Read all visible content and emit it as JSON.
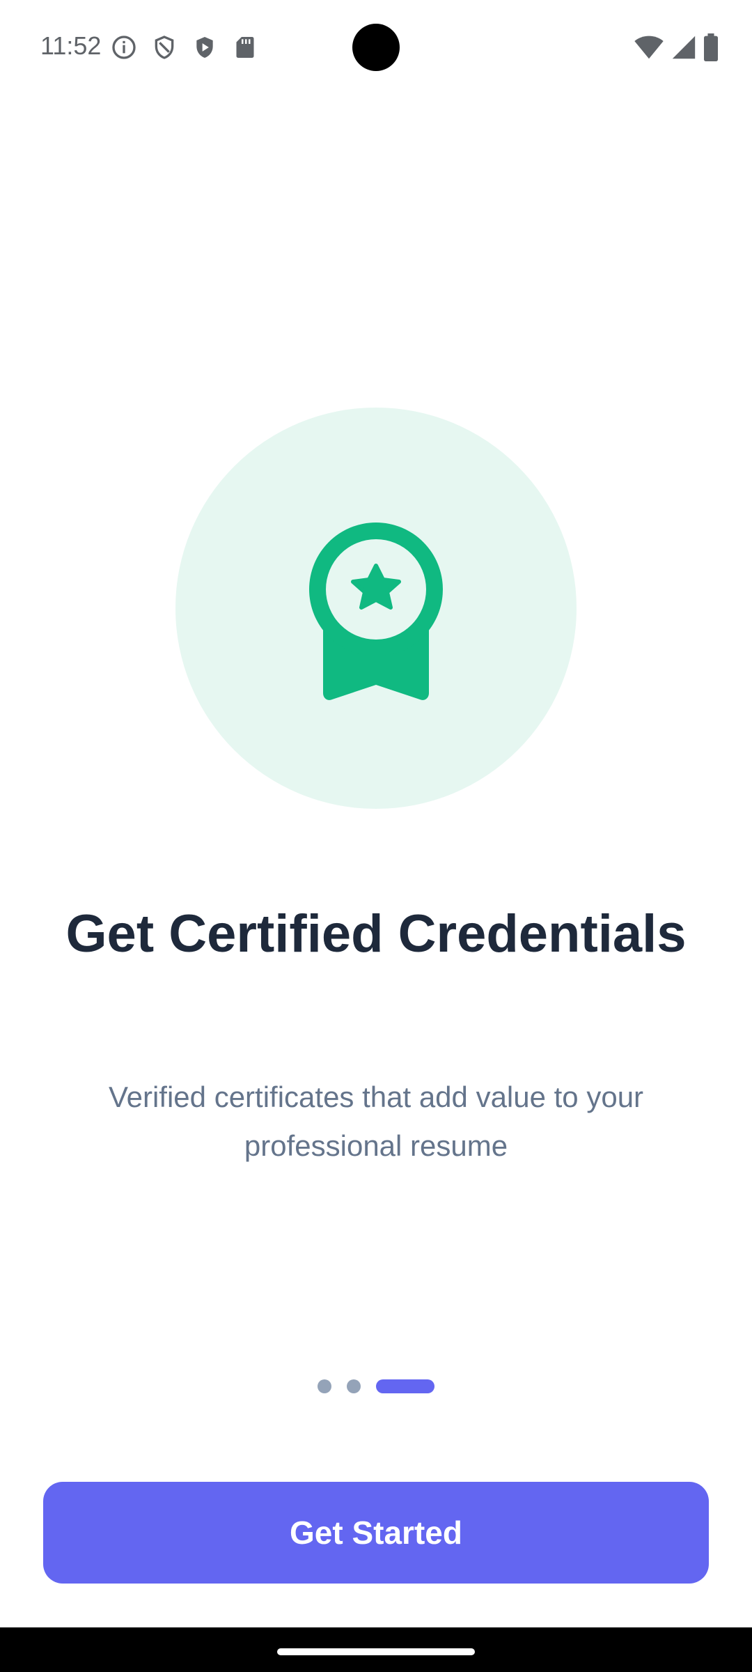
{
  "status_bar": {
    "time": "11:52",
    "left_icons": [
      "info-icon",
      "shield-outline-icon",
      "play-shield-icon",
      "sd-card-icon"
    ],
    "right_icons": [
      "wifi-icon",
      "cell-signal-icon",
      "battery-icon"
    ]
  },
  "hero": {
    "icon": "medal-icon",
    "circle_color": "#e6f7f1",
    "icon_color": "#10b981"
  },
  "onboarding": {
    "title": "Get Certified Credentials",
    "subtitle": "Verified certificates that add value to your professional resume"
  },
  "pager": {
    "total_pages": 3,
    "current_page": 3,
    "active_color": "#6366f1",
    "inactive_color": "#94a3b8"
  },
  "cta": {
    "label": "Get Started",
    "color": "#6366f1"
  }
}
